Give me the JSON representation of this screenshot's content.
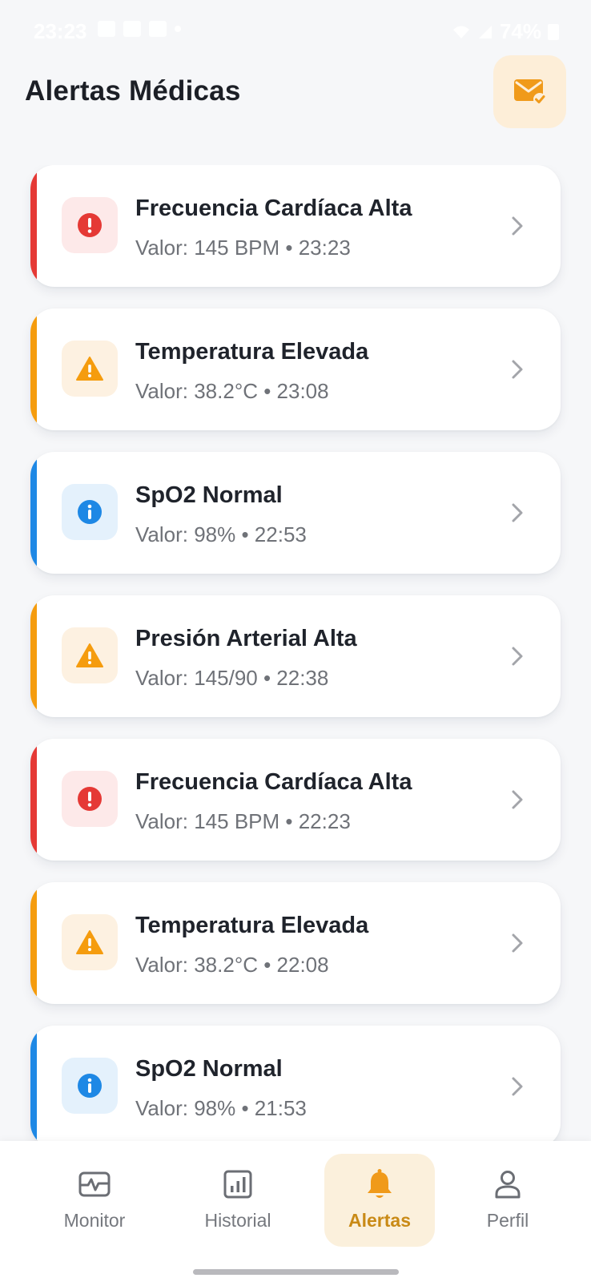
{
  "status_bar": {
    "time": "23:23",
    "battery": "74%"
  },
  "header": {
    "title": "Alertas Médicas",
    "action_icon": "mail-check-icon"
  },
  "colors": {
    "critical": "#e53935",
    "critical_bg": "#fde9e9",
    "warning": "#f59c0e",
    "warning_bg": "#fdf1e1",
    "info": "#1e88e5",
    "info_bg": "#e4f1fc",
    "accent": "#f09a1a",
    "accent_bg": "#fdeed8"
  },
  "alerts": [
    {
      "level": "critical",
      "icon": "exclamation-circle-icon",
      "title": "Frecuencia Cardíaca Alta",
      "detail": "Valor: 145 BPM • 23:23"
    },
    {
      "level": "warning",
      "icon": "warning-triangle-icon",
      "title": "Temperatura Elevada",
      "detail": "Valor: 38.2°C • 23:08"
    },
    {
      "level": "info",
      "icon": "info-circle-icon",
      "title": "SpO2 Normal",
      "detail": "Valor: 98% • 22:53"
    },
    {
      "level": "warning",
      "icon": "warning-triangle-icon",
      "title": "Presión Arterial Alta",
      "detail": "Valor: 145/90 • 22:38"
    },
    {
      "level": "critical",
      "icon": "exclamation-circle-icon",
      "title": "Frecuencia Cardíaca Alta",
      "detail": "Valor: 145 BPM • 22:23"
    },
    {
      "level": "warning",
      "icon": "warning-triangle-icon",
      "title": "Temperatura Elevada",
      "detail": "Valor: 38.2°C • 22:08"
    },
    {
      "level": "info",
      "icon": "info-circle-icon",
      "title": "SpO2 Normal",
      "detail": "Valor: 98% • 21:53"
    }
  ],
  "nav": {
    "items": [
      {
        "label": "Monitor",
        "icon": "activity-monitor-icon",
        "active": false
      },
      {
        "label": "Historial",
        "icon": "bar-chart-icon",
        "active": false
      },
      {
        "label": "Alertas",
        "icon": "bell-icon",
        "active": true
      },
      {
        "label": "Perfil",
        "icon": "user-icon",
        "active": false
      }
    ]
  }
}
